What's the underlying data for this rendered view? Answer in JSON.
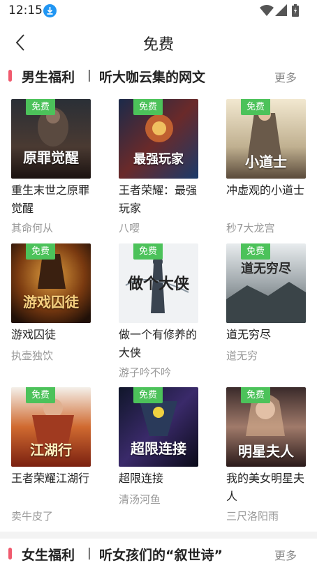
{
  "status": {
    "time": "12:15"
  },
  "header": {
    "title": "免费"
  },
  "sections": [
    {
      "title": "男生福利",
      "separator": "|",
      "subtitle": "听大咖云集的网文",
      "more": "更多",
      "books": [
        {
          "title": "重生末世之原罪觉醒",
          "author": "其命何从",
          "tag": "免费",
          "cover_text": "原罪觉醒"
        },
        {
          "title": "王者荣耀：最强玩家",
          "author": "八嘤",
          "tag": "免费",
          "cover_text": "最强玩家"
        },
        {
          "title": "冲虚观的小道士",
          "author": "秒7大龙宫",
          "tag": "免费",
          "cover_text": "小道士"
        },
        {
          "title": "游戏囚徒",
          "author": "执壶独饮",
          "tag": "免费",
          "cover_text": "游戏囚徒"
        },
        {
          "title": "做一个有修养的大侠",
          "author": "游子吟不吟",
          "tag": "免费",
          "cover_text": "做个大侠"
        },
        {
          "title": "道无穷尽",
          "author": "道无穷",
          "tag": "免费",
          "cover_text": "道无穷尽"
        },
        {
          "title": "王者荣耀江湖行",
          "author": "卖牛皮了",
          "tag": "免费",
          "cover_text": "江湖行"
        },
        {
          "title": "超限连接",
          "author": "清汤河鱼",
          "tag": "免费",
          "cover_text": "超限连接"
        },
        {
          "title": "我的美女明星夫人",
          "author": "三尺洛阳雨",
          "tag": "免费",
          "cover_text": "明星夫人"
        }
      ]
    },
    {
      "title": "女生福利",
      "separator": "|",
      "subtitle": "听女孩们的“叙世诗”",
      "more": "更多"
    }
  ],
  "colors": {
    "accent": "#f05a6e",
    "free_tag": "#4cc25a",
    "download_badge": "#2196f3"
  }
}
